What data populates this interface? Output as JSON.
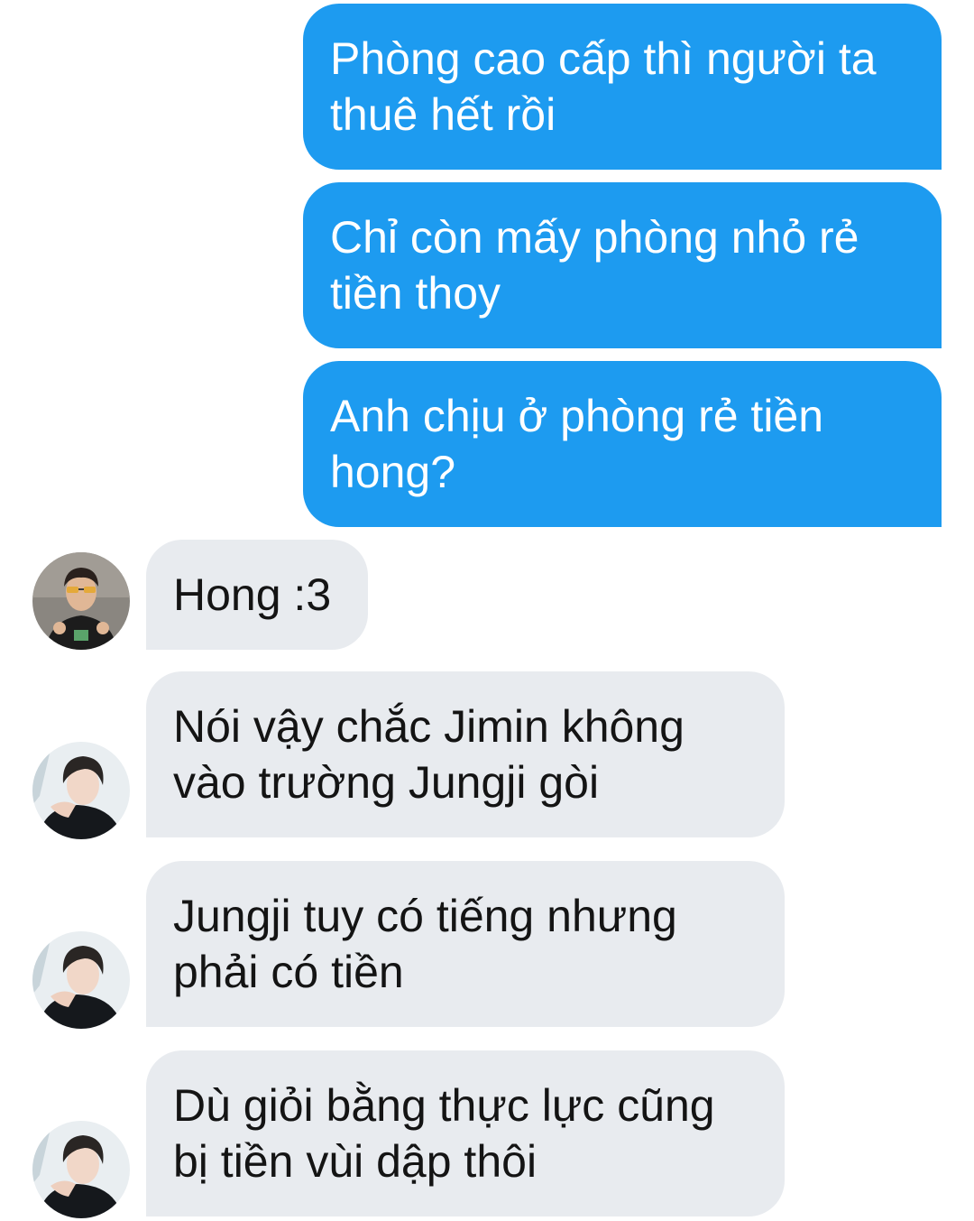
{
  "messages": [
    {
      "side": "sent",
      "text": "Phòng cao cấp thì người ta\nthuê hết rồi"
    },
    {
      "side": "sent",
      "text": "Chỉ còn mấy phòng nhỏ rẻ\ntiền thoy"
    },
    {
      "side": "sent",
      "text": "Anh chịu ở phòng rẻ tiền\nhong?"
    },
    {
      "side": "received",
      "avatar": "avatar-photo-glasses",
      "text": "Hong :3"
    },
    {
      "side": "received",
      "avatar": "avatar-photo",
      "text": "Nói vậy chắc Jimin không\nvào trường Jungji gòi"
    },
    {
      "side": "received",
      "avatar": "avatar-photo",
      "text": "Jungji tuy có tiếng nhưng\nphải có tiền"
    },
    {
      "side": "received",
      "avatar": "avatar-photo",
      "text": "Dù giỏi bằng thực lực cũng\nbị tiền vùi dập thôi"
    }
  ],
  "colors": {
    "sent_bubble": "#1d9bf0",
    "sent_text": "#ffffff",
    "received_bubble": "#e8ebef",
    "received_text": "#141414",
    "background": "#ffffff"
  }
}
